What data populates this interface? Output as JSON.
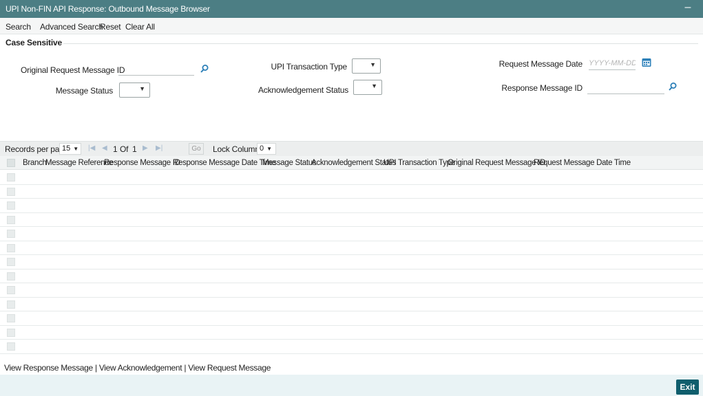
{
  "window": {
    "title": "UPI Non-FIN API Response: Outbound Message Browser",
    "minimize_glyph": "–"
  },
  "menu": {
    "search": "Search",
    "advanced_search": "Advanced Search",
    "reset": "Reset",
    "clear_all": "Clear All"
  },
  "criteria": {
    "section_label": "Case Sensitive",
    "original_request_message_id": {
      "label": "Original Request Message ID",
      "value": ""
    },
    "upi_transaction_type": {
      "label": "UPI Transaction Type",
      "value": ""
    },
    "request_message_date": {
      "label": "Request Message Date",
      "placeholder": "YYYY-MM-DD",
      "value": ""
    },
    "message_status": {
      "label": "Message Status",
      "value": ""
    },
    "acknowledgement_status": {
      "label": "Acknowledgement Status",
      "value": ""
    },
    "response_message_id": {
      "label": "Response Message ID",
      "value": ""
    }
  },
  "grid_toolbar": {
    "records_per_page_label": "Records per page",
    "records_per_page_value": "15",
    "page_current": "1",
    "page_of": "Of",
    "page_total": "1",
    "go_label": "Go",
    "lock_columns_label": "Lock Columns",
    "lock_columns_value": "0"
  },
  "columns": [
    "Branch",
    "Message Reference",
    "Response Message ID",
    "Response Message Date Time",
    "Message Status",
    "Acknowledgement Status",
    "UPI Transaction Type",
    "Original Request Message ID",
    "Request Message Date Time"
  ],
  "footer": {
    "view_response_message": "View Response Message",
    "separator": "|",
    "view_acknowledgement": "View Acknowledgement",
    "separator2": "|",
    "view_request_message": "View Request Message",
    "exit": "Exit"
  },
  "icons": {
    "search": "search-icon",
    "calendar": "calendar-icon",
    "dropdown": "caret-down-icon",
    "first_page": "first-page-icon",
    "prev_page": "prev-page-icon",
    "next_page": "next-page-icon",
    "last_page": "last-page-icon"
  },
  "colors": {
    "title_bar": "#4c7e84",
    "accent_icon": "#2b7fb8",
    "exit_button": "#0f5e6d",
    "bottom_bar": "#e9f3f5"
  }
}
